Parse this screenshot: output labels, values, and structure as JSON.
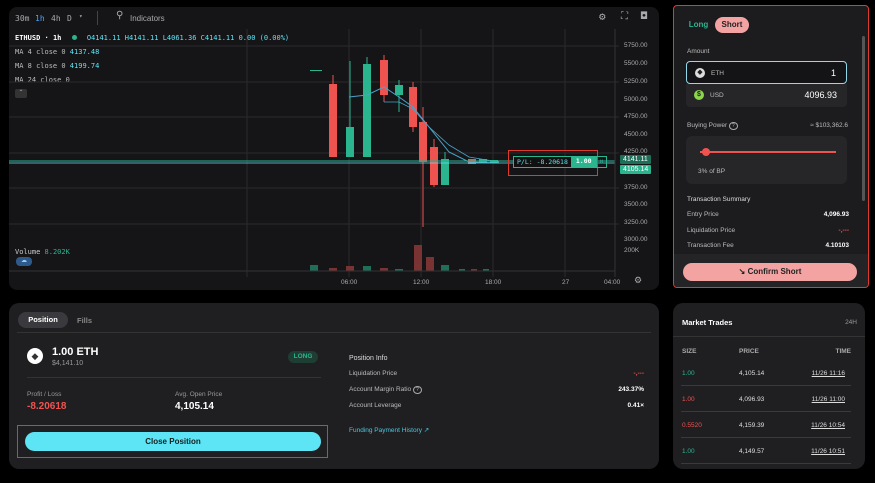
{
  "toolbar": {
    "intervals": [
      "30m",
      "1h",
      "4h",
      "D"
    ],
    "active": "1h",
    "indicators": "Indicators"
  },
  "legend": {
    "symbol": "ETHUSD",
    "interval": "1h",
    "o": "O4141.11",
    "h": "H4141.11",
    "l": "L4061.36",
    "c": "C4141.11",
    "chg": "0.00 (0.00%)",
    "ma4_label": "MA 4 close 0",
    "ma4_val": "4137.48",
    "ma8_label": "MA 8 close 0",
    "ma8_val": "4199.74",
    "ma24_label": "MA 24 close 0",
    "volume_label": "Volume",
    "volume_val": "8.202K"
  },
  "yaxis": [
    "5750.00",
    "5500.00",
    "5250.00",
    "5000.00",
    "4750.00",
    "4500.00",
    "4250.00",
    "3750.00",
    "3500.00",
    "3250.00",
    "3000.00"
  ],
  "price_tags": {
    "last": "4141.11",
    "second": "4105.14",
    "volume": "200K"
  },
  "xaxis": [
    "06:00",
    "12:00",
    "18:00",
    "27",
    "04:00"
  ],
  "pl_tag": {
    "label": "P/L: -8.20618",
    "qty": "1.00"
  },
  "order": {
    "long": "Long",
    "short": "Short",
    "amount_label": "Amount",
    "eth_label": "ETH",
    "eth_value": "1",
    "usd_label": "USD",
    "usd_value": "4096.93",
    "buying_power_label": "Buying Power",
    "buying_power_value": "≈ $103,362.6",
    "slider_label": "3% of BP",
    "slider_fraction": 0.03,
    "summary_title": "Transaction Summary",
    "entry_label": "Entry Price",
    "entry_value": "4,096.93",
    "liq_label": "Liquidation Price",
    "liq_value": "-,---",
    "fee_label": "Transaction Fee",
    "fee_value": "4.10103",
    "confirm": "Confirm Short"
  },
  "position": {
    "tab_active": "Position",
    "tab_other": "Fills",
    "size": "1.00 ETH",
    "usd": "$4,141.10",
    "side": "LONG",
    "pl_label": "Profit / Loss",
    "pl_value": "-8.20618",
    "avg_label": "Avg. Open Price",
    "avg_value": "4,105.14",
    "close": "Close Position",
    "info_title": "Position Info",
    "liq_label": "Liquidation Price",
    "liq_value": "-,---",
    "margin_label": "Account Margin Ratio",
    "margin_value": "243.37%",
    "lev_label": "Account Leverage",
    "lev_value": "0.41×",
    "funding": "Funding Payment History ↗"
  },
  "trades": {
    "title": "Market Trades",
    "period": "24H",
    "headers": [
      "SIZE",
      "PRICE",
      "TIME"
    ],
    "rows": [
      {
        "size": "1.00",
        "price": "4,105.14",
        "time": "11/26 11:16",
        "side": "buy"
      },
      {
        "size": "1.00",
        "price": "4,096.93",
        "time": "11/26 11:00",
        "side": "sell"
      },
      {
        "size": "0.5520",
        "price": "4,159.39",
        "time": "11/26 10:54",
        "side": "sell"
      },
      {
        "size": "1.00",
        "price": "4,149.57",
        "time": "11/26 10:51",
        "side": "buy"
      }
    ]
  },
  "colors": {
    "up": "#2bb58f",
    "down": "#ef5350",
    "accent": "#5ee5f5"
  }
}
